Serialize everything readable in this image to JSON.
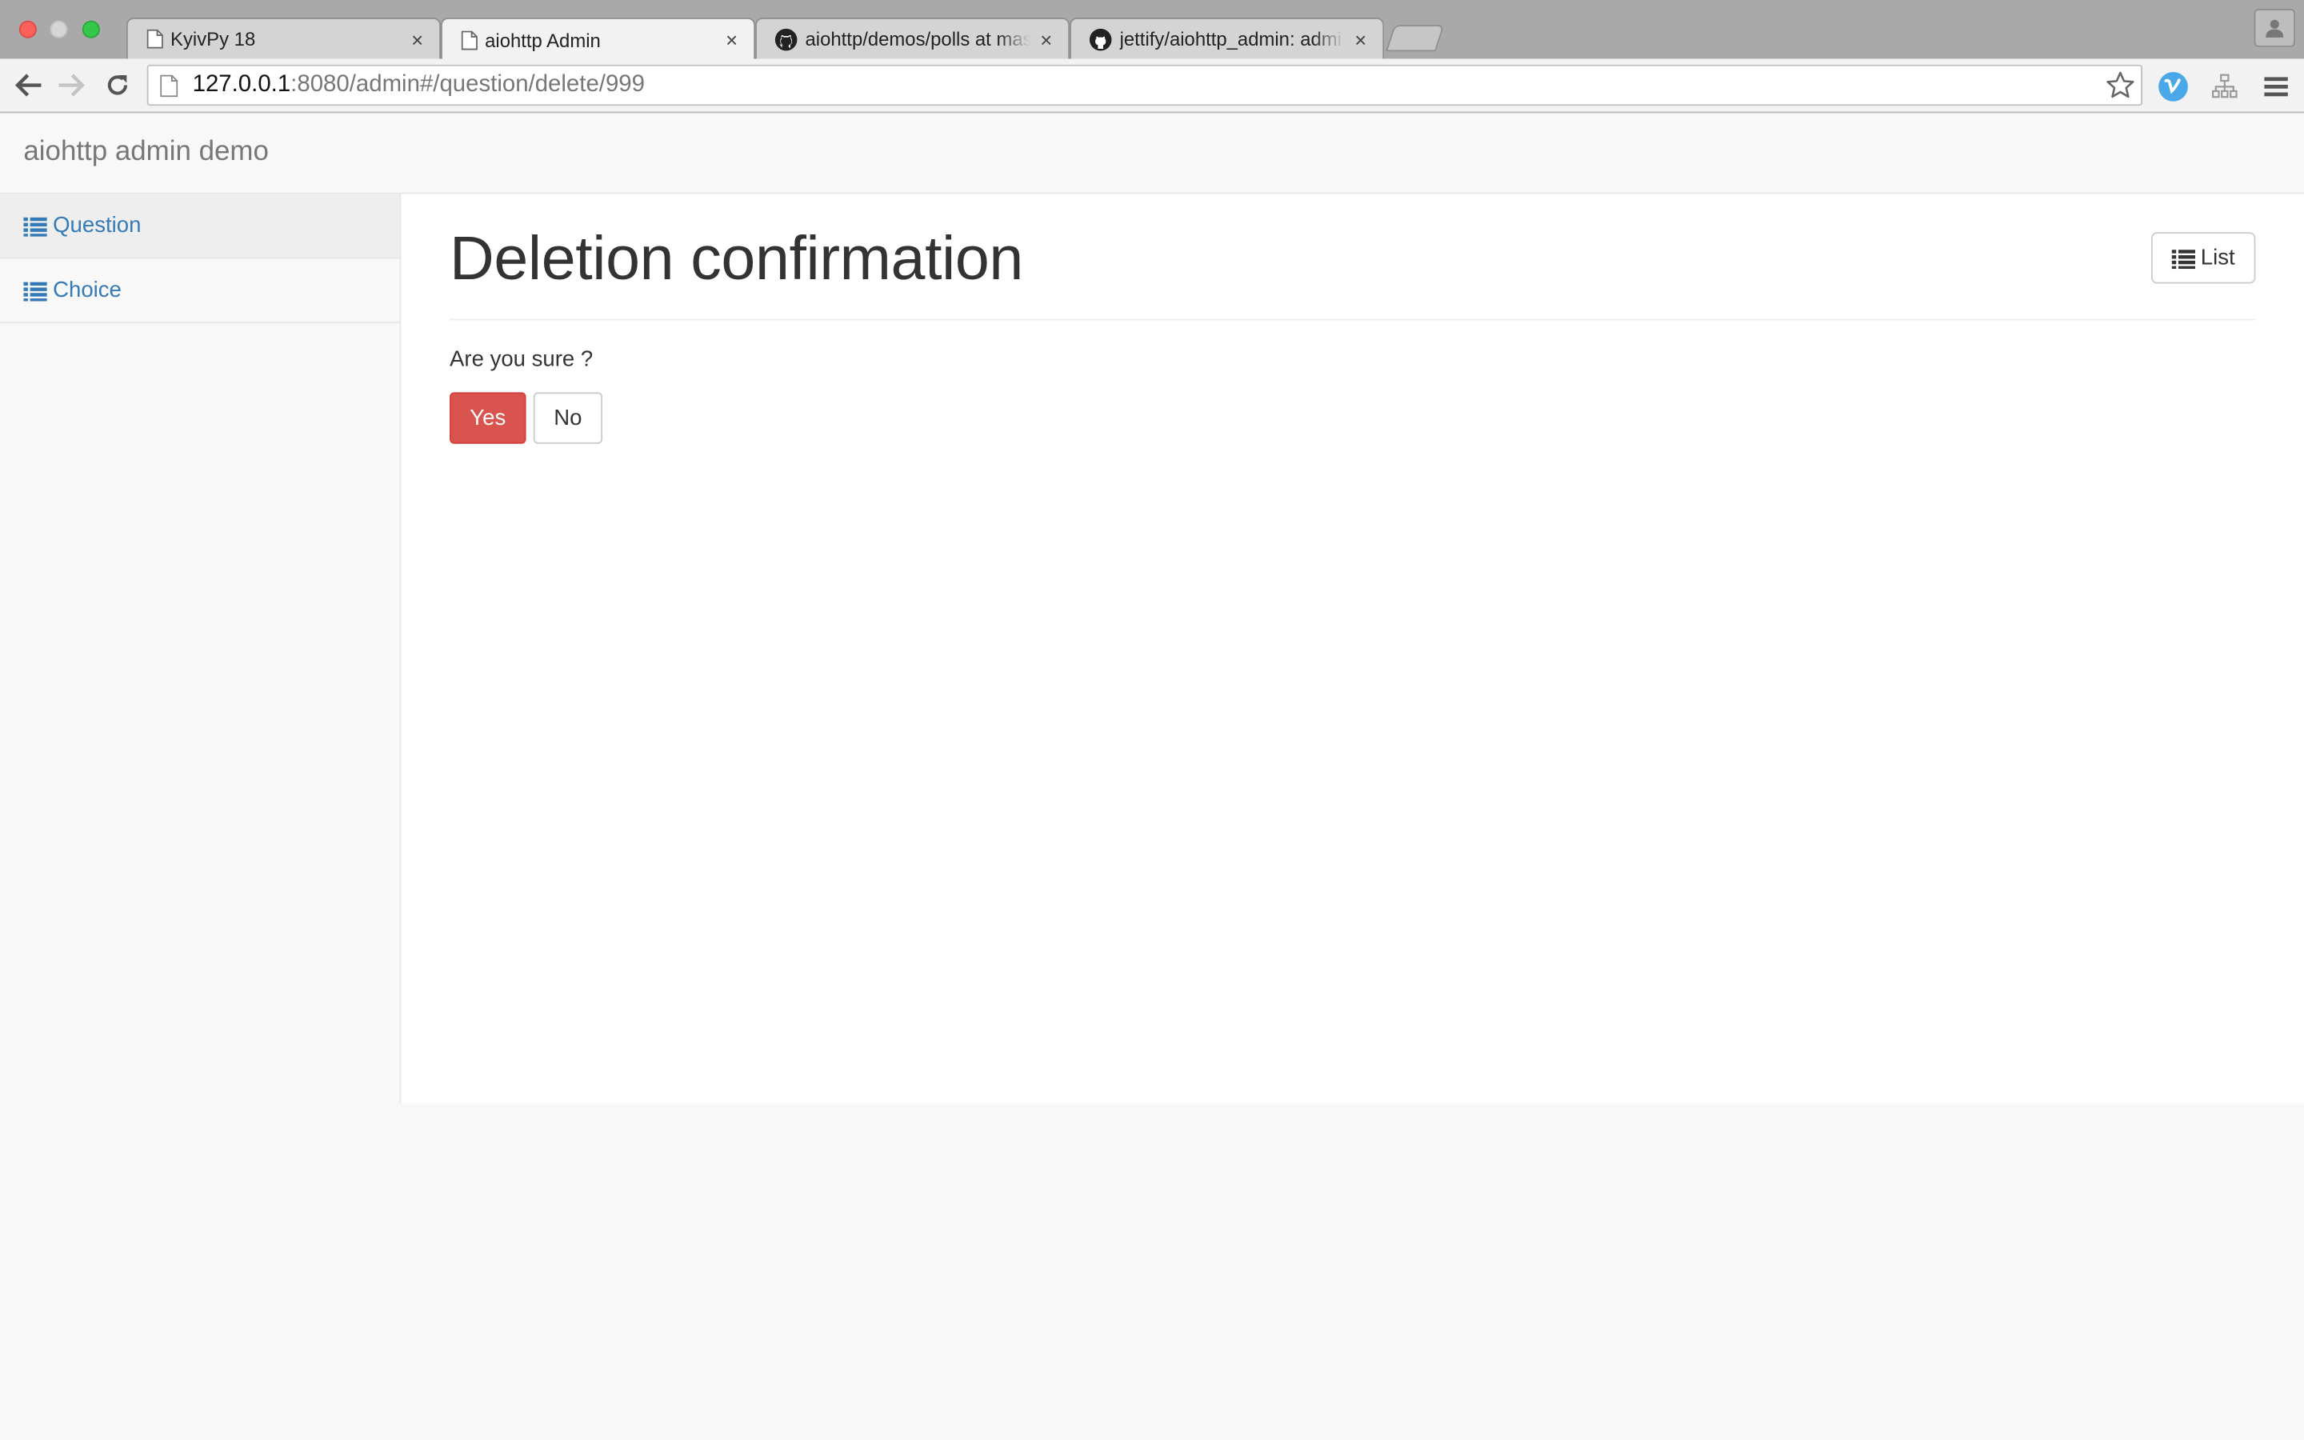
{
  "browser": {
    "tabs": [
      {
        "title": "KyivPy 18",
        "icon": "page-icon",
        "active": false
      },
      {
        "title": "aiohttp Admin",
        "icon": "page-icon",
        "active": true
      },
      {
        "title": "aiohttp/demos/polls at mas",
        "icon": "github-icon",
        "active": false
      },
      {
        "title": "jettify/aiohttp_admin: admi",
        "icon": "github-icon",
        "active": false
      }
    ],
    "tab_close_glyph": "×",
    "address": {
      "host": "127.0.0.1",
      "rest": ":8080/admin#/question/delete/999"
    }
  },
  "navbar": {
    "brand": "aiohttp admin demo"
  },
  "sidebar": {
    "items": [
      {
        "label": "Question",
        "icon": "list-icon",
        "active": true
      },
      {
        "label": "Choice",
        "icon": "list-icon",
        "active": false
      }
    ]
  },
  "main": {
    "title": "Deletion confirmation",
    "list_button_label": "List",
    "question": "Are you sure ?",
    "yes_label": "Yes",
    "no_label": "No"
  },
  "colors": {
    "link": "#337ab7",
    "danger": "#d9534f",
    "navbar_bg": "#f8f8f8",
    "text": "#333333"
  }
}
